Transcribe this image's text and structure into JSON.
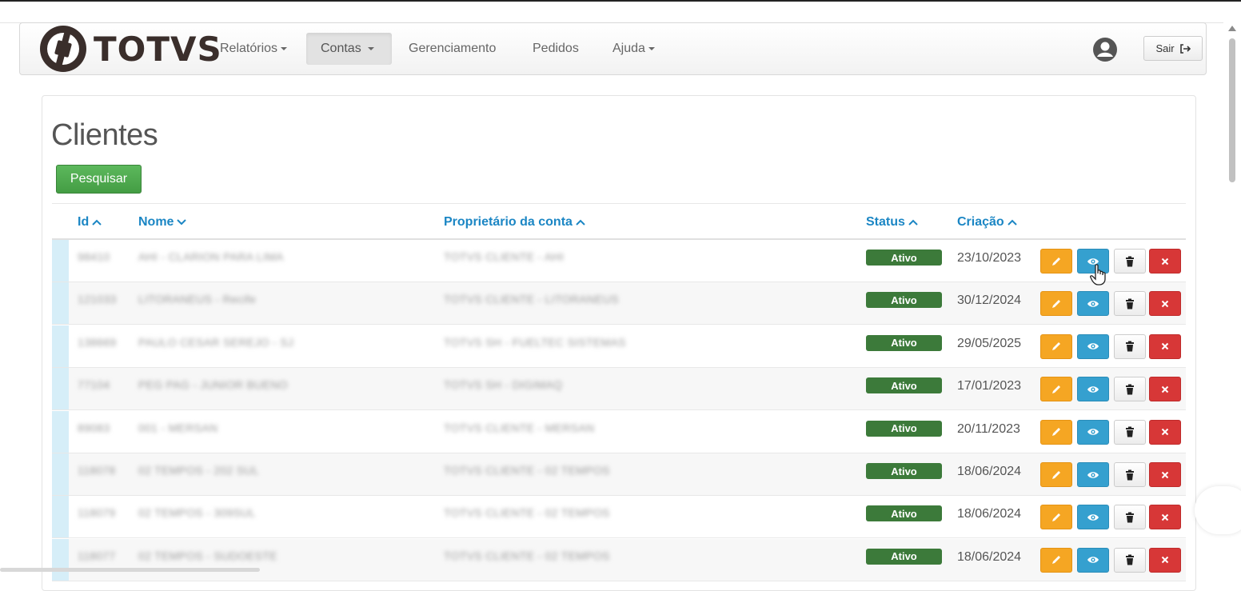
{
  "navbar": {
    "logo_text": "TOTVS",
    "menu": [
      {
        "label": "Relatórios",
        "caret": true,
        "active": false
      },
      {
        "label": "Contas",
        "caret": true,
        "active": true
      },
      {
        "label": "Gerenciamento",
        "caret": false,
        "active": false
      },
      {
        "label": "Pedidos",
        "caret": false,
        "active": false
      },
      {
        "label": "Ajuda",
        "caret": true,
        "active": false
      }
    ],
    "user_icon": "user-circle-icon",
    "logout_label": "Sair",
    "logout_icon": "sign-out-icon"
  },
  "page": {
    "title": "Clientes",
    "search_button": "Pesquisar"
  },
  "table": {
    "columns": [
      {
        "label": "Id",
        "sort": "up"
      },
      {
        "label": "Nome",
        "sort": "down"
      },
      {
        "label": "Proprietário da conta",
        "sort": "up"
      },
      {
        "label": "Status",
        "sort": "up"
      },
      {
        "label": "Criação",
        "sort": "up"
      }
    ],
    "rows": [
      {
        "id": "98410",
        "name": "AHI - CLARION PARA LIMA",
        "owner": "TOTVS CLIENTE - AHI",
        "status": "Ativo",
        "created": "23/10/2023"
      },
      {
        "id": "121033",
        "name": "LITORANEUS - Recife",
        "owner": "TOTVS CLIENTE - LITORANEUS",
        "status": "Ativo",
        "created": "30/12/2024"
      },
      {
        "id": "138669",
        "name": "PAULO CESAR SEREJO - SJ",
        "owner": "TOTVS SH - FUELTEC SISTEMAS",
        "status": "Ativo",
        "created": "29/05/2025"
      },
      {
        "id": "77104",
        "name": "PEG PAG - JUNIOR BUENO",
        "owner": "TOTVS SH - DIGIMAQ",
        "status": "Ativo",
        "created": "17/01/2023"
      },
      {
        "id": "89083",
        "name": "001 - MERSAN",
        "owner": "TOTVS CLIENTE - MERSAN",
        "status": "Ativo",
        "created": "20/11/2023"
      },
      {
        "id": "118078",
        "name": "02 TEMPOS - 202 SUL",
        "owner": "TOTVS CLIENTE - 02 TEMPOS",
        "status": "Ativo",
        "created": "18/06/2024"
      },
      {
        "id": "118079",
        "name": "02 TEMPOS - 309SUL",
        "owner": "TOTVS CLIENTE - 02 TEMPOS",
        "status": "Ativo",
        "created": "18/06/2024"
      },
      {
        "id": "118077",
        "name": "02 TEMPOS - SUDOESTE",
        "owner": "TOTVS CLIENTE - 02 TEMPOS",
        "status": "Ativo",
        "created": "18/06/2024"
      }
    ],
    "row_actions": [
      "pencil-icon",
      "eye-icon",
      "trash-icon",
      "close-icon"
    ]
  },
  "colors": {
    "accent_blue": "#1b86c4",
    "status_green": "#3c7a3a",
    "edit_orange": "#f5a623",
    "view_blue": "#35a0cf",
    "delete_red": "#d73737",
    "search_green": "#5cb85c"
  }
}
